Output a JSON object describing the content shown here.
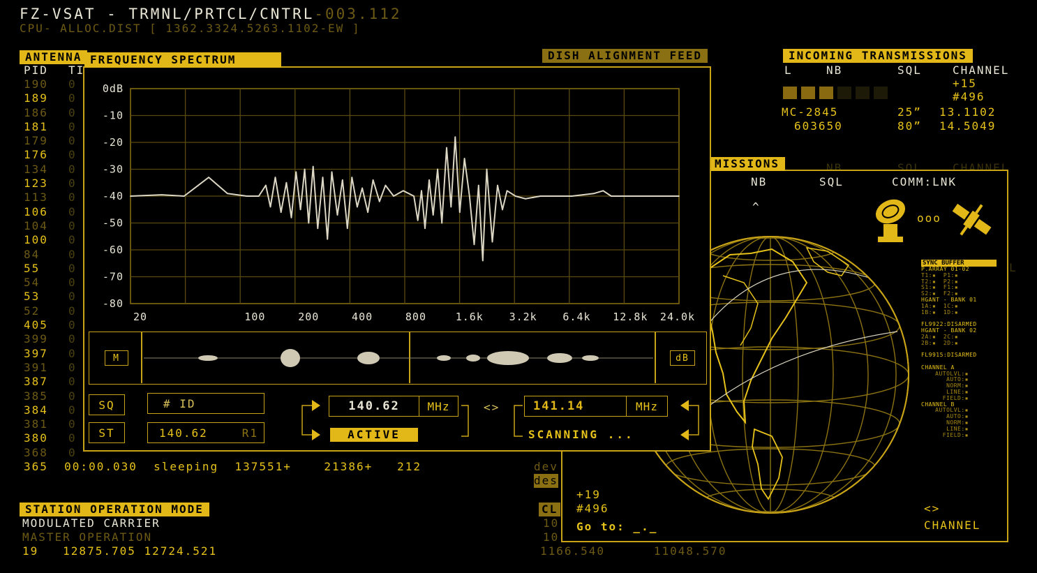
{
  "title": {
    "main": "FZ-VSAT  - TRMNL/PRTCL/CNTRL",
    "code": "-003.112",
    "sub": "CPU- ALLOC.DIST [ 1362.3324.5263.1102-EW ]"
  },
  "antenna": {
    "header": "ANTENNA",
    "col_pid": "PID",
    "col_ti": "TI",
    "rows": [
      "190",
      "189",
      "186",
      "181",
      "179",
      "176",
      "134",
      "123",
      "113",
      "106",
      "104",
      "100",
      "84",
      "55",
      "54",
      "53",
      "52",
      "405",
      "399",
      "397",
      "391",
      "387",
      "385",
      "384",
      "381",
      "380",
      "368",
      "365"
    ],
    "rows_col2": [
      "0",
      "0",
      "0",
      "0",
      "0",
      "0",
      "0",
      "0",
      "0",
      "0",
      "0",
      "0",
      "0",
      "0",
      "0",
      "0",
      "0",
      "0",
      "0",
      "0",
      "0",
      "0",
      "0",
      "0",
      "0",
      "0",
      "0"
    ],
    "last_row": "365  00:00.030  sleeping  137551+    21386+   212"
  },
  "station": {
    "header": "STATION OPERATION MODE",
    "line1": "MODULATED CARRIER",
    "line2": "MASTER OPERATION",
    "line3": "19   12875.705 12724.521"
  },
  "dish": {
    "header": "DISH ALIGNMENT FEED",
    "side1": "dev",
    "side2": "des",
    "cl_header": "CL",
    "cl_r1": "10",
    "cl_r2": "10",
    "bottom": "1166.540      11048.570"
  },
  "incoming": {
    "header": "INCOMING TRANSMISSIONS",
    "cols": [
      "L",
      "NB",
      "SQL",
      "CHANNEL"
    ],
    "plus": "+15",
    "hash": "#496",
    "row1": [
      "MC-2845",
      "25”",
      "13.1102"
    ],
    "row2": [
      "603650",
      "80”",
      "14.5049"
    ]
  },
  "missions": {
    "header": "MISSIONS",
    "cols": [
      "NB",
      "SQL",
      "COMM:LNK"
    ],
    "ghost_cols": [
      "NB",
      "SQL",
      "CHANNEL"
    ],
    "caret": "^",
    "dots": "ooo",
    "plus": "+19",
    "hash": "#496",
    "goto": "Go to: _._",
    "arrows": "<>",
    "channel": "CHANNEL",
    "ghost_l": "L",
    "sync": {
      "title": "SYNC BUFFER",
      "lines": [
        "P.ARRAY 01-02",
        "T1:▪  P1:▪",
        "T2:▪  P2:▪",
        "S1:▪  F1:▪",
        "S2:▪  F2:▪",
        "HGANT - BANK 01",
        "1A:▪  1C:▪",
        "1B:▪  1D:▪",
        "",
        "FL9922:DISARMED",
        "HGANT - BANK 02",
        "2A:▪  2C:▪",
        "2B:▪  2D:▪",
        "",
        "FL9915:DISARMED",
        "",
        "CHANNEL A",
        "AUTOLVL:▪",
        "AUTO:▪",
        "NORM:▪",
        "LINE:▪",
        "FIELD:▪",
        "CHANNEL B",
        "AUTOLVL:▪",
        "AUTO:▪",
        "NORM:▪",
        "LINE:▪",
        "FIELD:▪"
      ]
    }
  },
  "spectrum": {
    "header": "FREQUENCY SPECTRUM",
    "ghost_header": "DISH ALIGNMENT FEED",
    "y_labels": [
      "0dB",
      "-10",
      "-20",
      "-30",
      "-40",
      "-50",
      "-60",
      "-70",
      "-80"
    ],
    "x_labels": [
      "20",
      "100",
      "200",
      "400",
      "800",
      "1.6k",
      "3.2k",
      "6.4k",
      "12.8k",
      "24.0k"
    ],
    "m_label": "M",
    "db_label": "dB",
    "sq": "SQ",
    "st": "ST",
    "id_label": "# ID",
    "st_value": "140.62",
    "st_suffix": "R1",
    "freq1": "140.62",
    "freq2": "141.14",
    "unit": "MHz",
    "active": "ACTIVE",
    "scanning": "SCANNING ...",
    "swap": "<>"
  },
  "colors": {
    "accent": "#e2b819",
    "dim": "#4d420f",
    "text_white": "#e9e6d6",
    "grid": "#5a4a10"
  },
  "chart_data": {
    "type": "line",
    "title": "FREQUENCY SPECTRUM",
    "xlabel": "",
    "ylabel": "",
    "x_scale": "log",
    "x_ticks": [
      "20",
      "100",
      "200",
      "400",
      "800",
      "1.6k",
      "3.2k",
      "6.4k",
      "12.8k",
      "24.0k"
    ],
    "ylim": [
      -80,
      0
    ],
    "series": [
      {
        "values": [
          [
            20,
            -40
          ],
          [
            30,
            -39.5
          ],
          [
            40,
            -40
          ],
          [
            48,
            -36
          ],
          [
            55,
            -33
          ],
          [
            62,
            -36
          ],
          [
            70,
            -39
          ],
          [
            90,
            -40
          ],
          [
            105,
            -40
          ],
          [
            115,
            -36
          ],
          [
            122,
            -44
          ],
          [
            130,
            -33
          ],
          [
            140,
            -46
          ],
          [
            150,
            -35
          ],
          [
            160,
            -48
          ],
          [
            170,
            -31
          ],
          [
            180,
            -45
          ],
          [
            190,
            -30
          ],
          [
            200,
            -50
          ],
          [
            212,
            -29
          ],
          [
            225,
            -52
          ],
          [
            240,
            -33
          ],
          [
            255,
            -56
          ],
          [
            270,
            -31
          ],
          [
            290,
            -47
          ],
          [
            310,
            -34
          ],
          [
            330,
            -52
          ],
          [
            350,
            -33
          ],
          [
            375,
            -44
          ],
          [
            400,
            -37
          ],
          [
            430,
            -46
          ],
          [
            460,
            -34
          ],
          [
            500,
            -42
          ],
          [
            540,
            -36
          ],
          [
            600,
            -40
          ],
          [
            680,
            -38
          ],
          [
            780,
            -40
          ],
          [
            820,
            -49
          ],
          [
            860,
            -38
          ],
          [
            900,
            -52
          ],
          [
            950,
            -34
          ],
          [
            1000,
            -47
          ],
          [
            1060,
            -30
          ],
          [
            1120,
            -50
          ],
          [
            1190,
            -22
          ],
          [
            1260,
            -44
          ],
          [
            1330,
            -18
          ],
          [
            1410,
            -46
          ],
          [
            1500,
            -26
          ],
          [
            1600,
            -40
          ],
          [
            1700,
            -58
          ],
          [
            1800,
            -36
          ],
          [
            1900,
            -64
          ],
          [
            2000,
            -30
          ],
          [
            2150,
            -57
          ],
          [
            2300,
            -36
          ],
          [
            2450,
            -45
          ],
          [
            2600,
            -38
          ],
          [
            2900,
            -40
          ],
          [
            3300,
            -41
          ],
          [
            4000,
            -40
          ],
          [
            6000,
            -40
          ],
          [
            8000,
            -39
          ],
          [
            9000,
            -38
          ],
          [
            10000,
            -40
          ],
          [
            14000,
            -40
          ],
          [
            24000,
            -40
          ]
        ]
      }
    ],
    "grid": true
  }
}
